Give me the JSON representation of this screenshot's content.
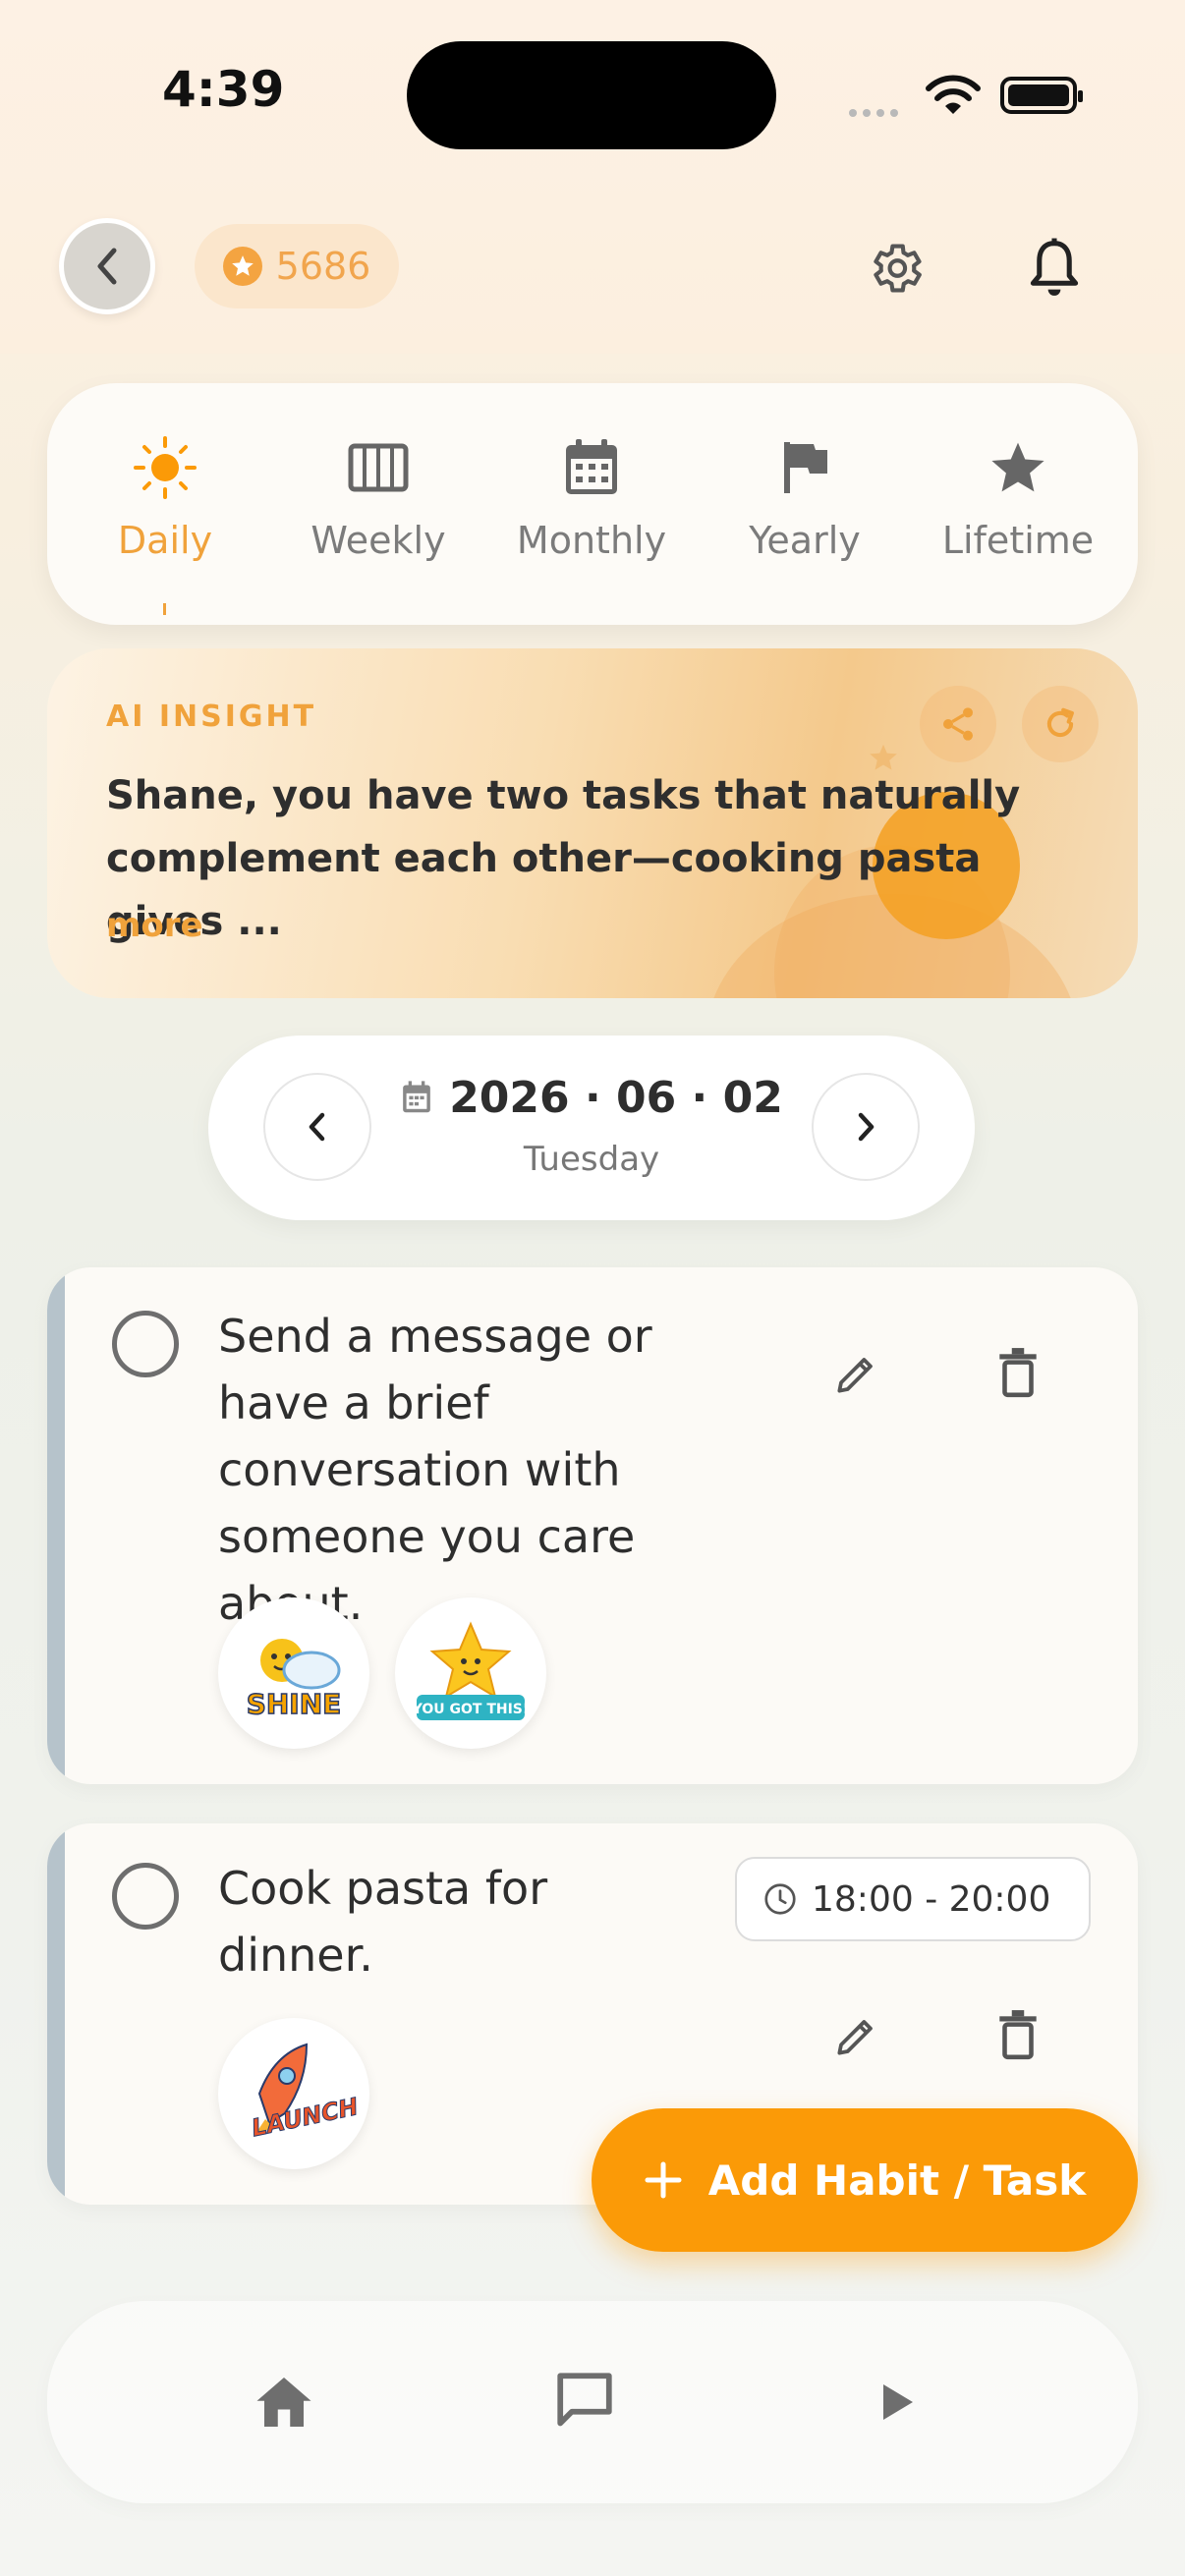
{
  "status_bar": {
    "time": "4:39"
  },
  "header": {
    "points": "5686"
  },
  "tabs": [
    {
      "label": "Daily",
      "icon": "sun-icon",
      "active": true
    },
    {
      "label": "Weekly",
      "icon": "columns-icon"
    },
    {
      "label": "Monthly",
      "icon": "calendar-icon"
    },
    {
      "label": "Yearly",
      "icon": "flag-icon"
    },
    {
      "label": "Lifetime",
      "icon": "star-icon"
    }
  ],
  "insight": {
    "label": "AI INSIGHT",
    "text": "Shane, you have two tasks that naturally complement each other—cooking pasta gives ...",
    "more": "more"
  },
  "date": {
    "main": "2026 · 06 · 02",
    "weekday": "Tuesday"
  },
  "tasks": [
    {
      "title": "Send a message or have a brief conversation with someone you care about.",
      "stickers": [
        {
          "name": "shine-sticker",
          "text": "SHINE"
        },
        {
          "name": "you-got-this-sticker",
          "text": "YOU GOT THIS!"
        }
      ]
    },
    {
      "title": "Cook pasta for dinner.",
      "time": "18:00 - 20:00",
      "stickers": [
        {
          "name": "launch-sticker",
          "text": "LAUNCH"
        }
      ]
    }
  ],
  "fab": {
    "label": "Add Habit / Task"
  },
  "colors": {
    "accent": "#fb9a07",
    "accent_text": "#f0a23b",
    "strip": "#b6c3cb"
  }
}
